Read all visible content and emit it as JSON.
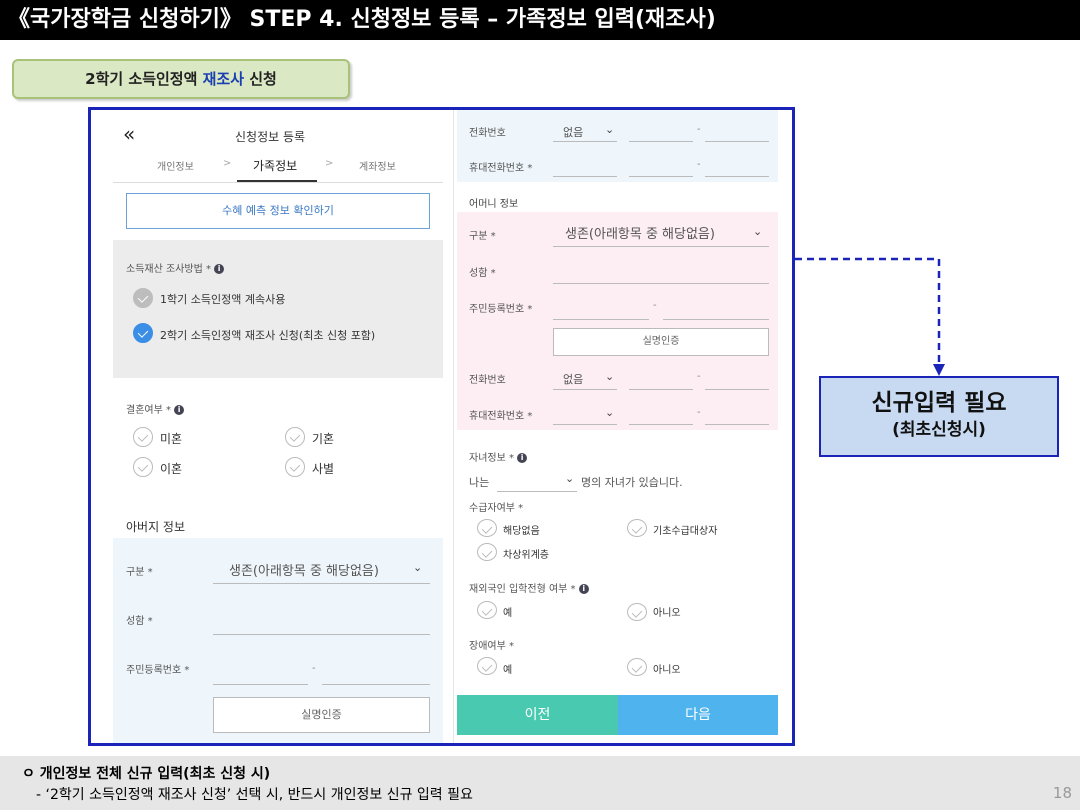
{
  "header": {
    "title": "《국가장학금 신청하기》 STEP 4. 신청정보 등록 – 가족정보 입력(재조사)"
  },
  "tag": {
    "prefix": "2학기 소득인정액 ",
    "highlight": "재조사",
    "suffix": " 신청"
  },
  "app": {
    "back_icon": "«",
    "title": "신청정보 등록",
    "steps": [
      "개인정보",
      "가족정보",
      "계좌정보"
    ],
    "step_sep": ">",
    "check_button": "수혜 예측 정보 확인하기",
    "survey": {
      "label": "소득재산 조사방법 *",
      "options": [
        "1학기 소득인정액 계속사용",
        "2학기 소득인정액 재조사 신청(최초 신청 포함)"
      ]
    },
    "marriage": {
      "label": "결혼여부 *",
      "options": [
        "미혼",
        "기혼",
        "이혼",
        "사별"
      ]
    },
    "father": {
      "section": "아버지 정보",
      "type_label": "구분 *",
      "type_value": "생존(아래항목 중 해당없음)",
      "name_label": "성함 *",
      "ssn_label": "주민등록번호 *",
      "ssn_dash": "-",
      "verify_button": "실명인증",
      "phone_label": "전화번호",
      "phone_value": "없음",
      "mobile_label": "휴대전화번호 *",
      "dash": "-"
    },
    "mother": {
      "section": "어머니 정보",
      "type_label": "구분 *",
      "type_value": "생존(아래항목 중 해당없음)",
      "name_label": "성함 *",
      "ssn_label": "주민등록번호 *",
      "ssn_dash": "-",
      "verify_button": "실명인증",
      "phone_label": "전화번호",
      "phone_value": "없음",
      "mobile_label": "휴대전화번호 *",
      "dash": "-"
    },
    "children": {
      "label": "자녀정보 *",
      "prefix": "나는",
      "suffix": "명의 자녀가 있습니다."
    },
    "welfare": {
      "label": "수급자여부 *",
      "options": [
        "해당없음",
        "기초수급대상자",
        "차상위계층"
      ]
    },
    "overseas": {
      "label": "재외국인 입학전형 여부 *",
      "options": [
        "예",
        "아니오"
      ]
    },
    "disability": {
      "label": "장애여부 *",
      "options": [
        "예",
        "아니오"
      ]
    },
    "prev_button": "이전",
    "next_button": "다음"
  },
  "callout": {
    "line1": "신규입력 필요",
    "line2": "(최초신청시)"
  },
  "footer": {
    "line1": "ㅇ 개인정보 전체 신규 입력(최초 신청 시)",
    "line2": "- ‘2학기 소득인정액 재조사 신청’ 선택 시, 반드시 개인정보 신규 입력 필요",
    "page": "18"
  },
  "colors": {
    "accent": "#1a24b8",
    "mint": "#49c9b0",
    "sky": "#4fb3ee",
    "pink": "#fdeef3",
    "lightblue": "#eef6fc"
  }
}
